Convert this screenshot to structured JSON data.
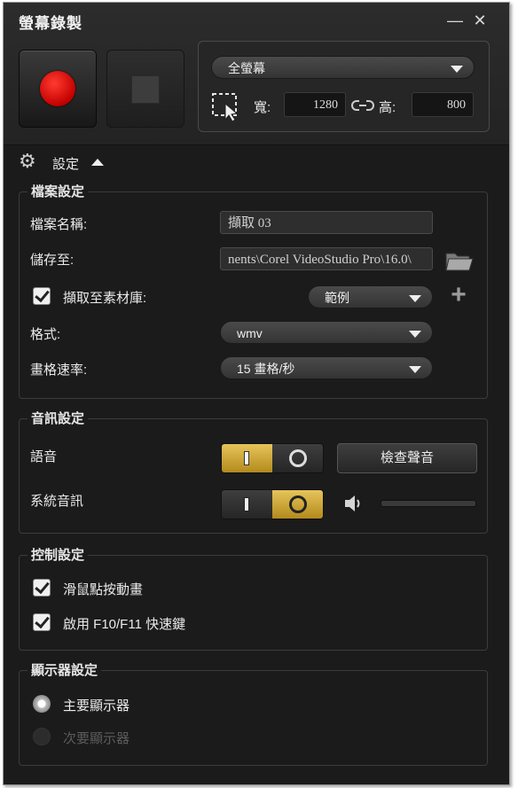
{
  "window": {
    "title": "螢幕錄製",
    "minimize_glyph": "—",
    "close_glyph": "✕"
  },
  "capture": {
    "region_select": "全螢幕",
    "width_label": "寬:",
    "width_value": "1280",
    "height_label": "高:",
    "height_value": "800"
  },
  "settings_toggle_label": "設定",
  "file_settings": {
    "title": "檔案設定",
    "filename_label": "檔案名稱:",
    "filename_value": "擷取 03",
    "save_to_label": "儲存至:",
    "save_to_value": "nents\\Corel VideoStudio Pro\\16.0\\",
    "capture_library_label": "擷取至素材庫:",
    "capture_library_checked": true,
    "library_select": "範例",
    "format_label": "格式:",
    "format_select": "wmv",
    "framerate_label": "畫格速率:",
    "framerate_select": "15 畫格/秒"
  },
  "audio_settings": {
    "title": "音訊設定",
    "voice_label": "語音",
    "voice_on": true,
    "check_sound_label": "檢查聲音",
    "system_audio_label": "系統音訊",
    "system_audio_on": false
  },
  "control_settings": {
    "title": "控制設定",
    "mouse_click_label": "滑鼠點按動畫",
    "mouse_click_checked": true,
    "hotkey_label": "啟用 F10/F11 快速鍵",
    "hotkey_checked": true
  },
  "display_settings": {
    "title": "顯示器設定",
    "primary_label": "主要顯示器",
    "secondary_label": "次要顯示器",
    "selected": "主要顯示器"
  }
}
